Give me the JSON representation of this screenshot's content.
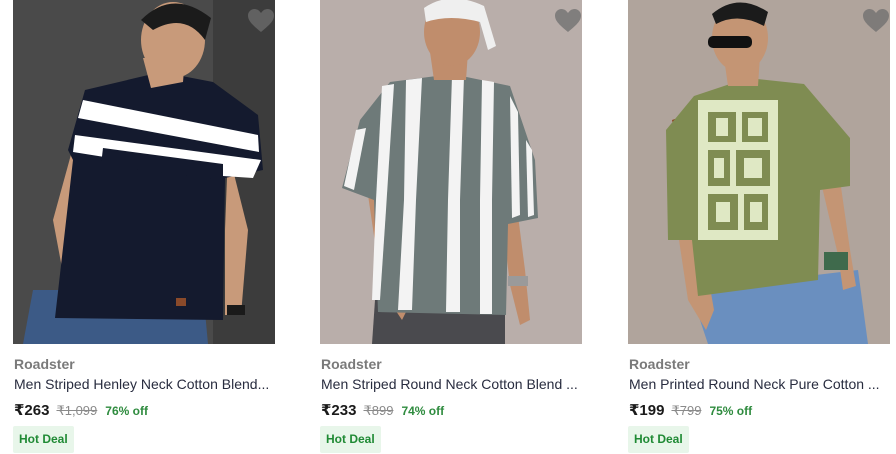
{
  "products": [
    {
      "brand": "Roadster",
      "title": "Men Striped Henley Neck Cotton Blend...",
      "price": "₹263",
      "mrp": "₹1,099",
      "discount": "76% off",
      "badge": "Hot Deal",
      "image": "navy-white-striped-henley-tshirt"
    },
    {
      "brand": "Roadster",
      "title": "Men Striped Round Neck Cotton Blend ...",
      "price": "₹233",
      "mrp": "₹899",
      "discount": "74% off",
      "badge": "Hot Deal",
      "image": "grey-white-vertical-striped-tshirt"
    },
    {
      "brand": "Roadster",
      "title": "Men Printed Round Neck Pure Cotton ...",
      "price": "₹199",
      "mrp": "₹799",
      "discount": "75% off",
      "badge": "Hot Deal",
      "image": "olive-printed-roadster-tshirt"
    }
  ],
  "colors": {
    "discount": "#2e8b3e",
    "badge_bg": "#e8f6ea",
    "badge_text": "#1f8a34",
    "brand_text": "#7a7a7a"
  },
  "icons": {
    "wishlist": "heart-icon"
  }
}
